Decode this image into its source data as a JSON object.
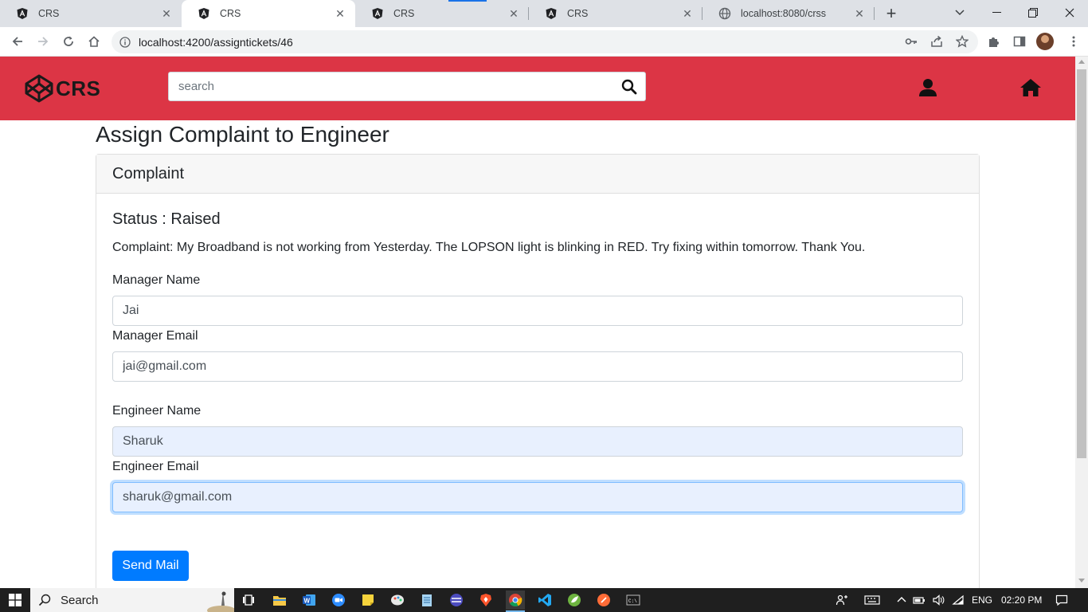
{
  "browser": {
    "tabs": [
      {
        "title": "CRS",
        "active": false
      },
      {
        "title": "CRS",
        "active": true
      },
      {
        "title": "CRS",
        "active": false
      },
      {
        "title": "CRS",
        "active": false
      },
      {
        "title": "localhost:8080/crss",
        "active": false
      }
    ],
    "url": "localhost:4200/assigntickets/46"
  },
  "navbar": {
    "brand": "CRS",
    "search_placeholder": "search",
    "color": "#dc3545"
  },
  "page": {
    "title": "Assign Complaint to Engineer",
    "card_header": "Complaint",
    "status": "Status : Raised",
    "complaint": "Complaint: My Broadband is not working from Yesterday. The LOPSON light is blinking in RED. Try fixing within tomorrow. Thank You.",
    "fields": {
      "manager_name_label": "Manager Name",
      "manager_name_value": "Jai",
      "manager_email_label": "Manager Email",
      "manager_email_value": "jai@gmail.com",
      "engineer_name_label": "Engineer Name",
      "engineer_name_value": "Sharuk",
      "engineer_email_label": "Engineer Email",
      "engineer_email_value": "sharuk@gmail.com"
    },
    "send_button": "Send Mail"
  },
  "taskbar": {
    "search_label": "Search",
    "language": "ENG",
    "time": "02:20 PM"
  }
}
